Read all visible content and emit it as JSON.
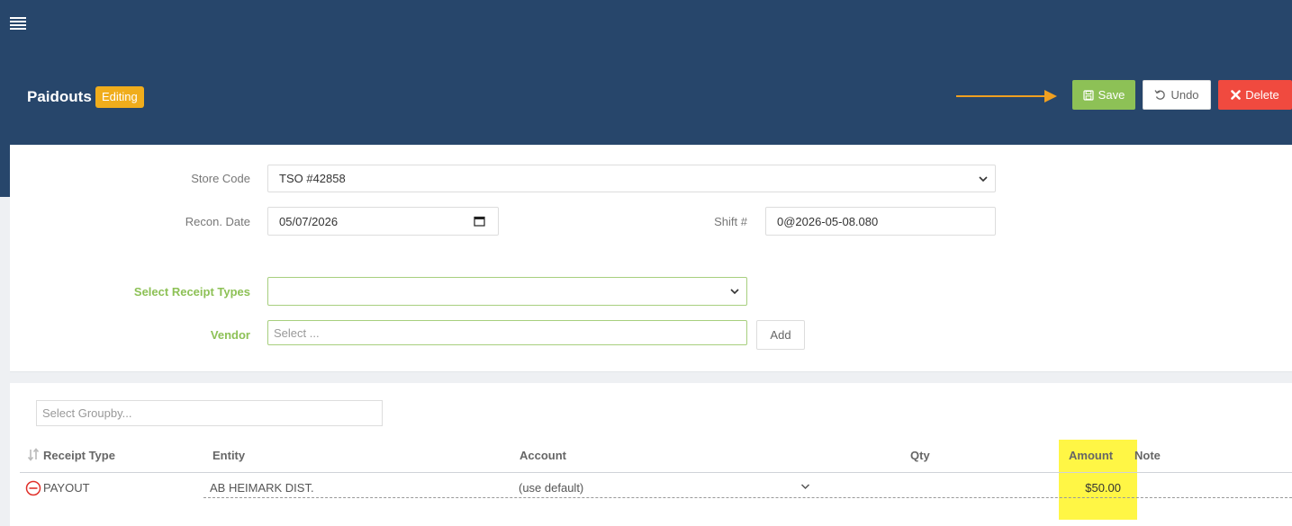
{
  "header": {
    "title": "Paidouts",
    "badge": "Editing",
    "save_label": "Save",
    "undo_label": "Undo",
    "delete_label": "Delete",
    "accent_color": "#27466b",
    "save_color": "#8dc156",
    "delete_color": "#f04a3f",
    "badge_color": "#f0ad1c"
  },
  "form": {
    "store_code_label": "Store Code",
    "store_code_value": "TSO #42858",
    "recon_date_label": "Recon. Date",
    "recon_date_value": "05/07/2026",
    "shift_label": "Shift #",
    "shift_value": "0@2026-05-08.080",
    "receipt_types_label": "Select Receipt Types",
    "receipt_types_value": "",
    "vendor_label": "Vendor",
    "vendor_placeholder": "Select ...",
    "add_label": "Add"
  },
  "table": {
    "groupby_placeholder": "Select Groupby...",
    "columns": {
      "receipt_type": "Receipt Type",
      "entity": "Entity",
      "account": "Account",
      "qty": "Qty",
      "amount": "Amount",
      "note": "Note"
    },
    "rows": [
      {
        "receipt_type": "PAYOUT",
        "entity": "AB HEIMARK DIST.",
        "account": "(use default)",
        "qty": "",
        "amount": "$50.00",
        "note": ""
      }
    ],
    "highlight_color": "#fff645"
  }
}
